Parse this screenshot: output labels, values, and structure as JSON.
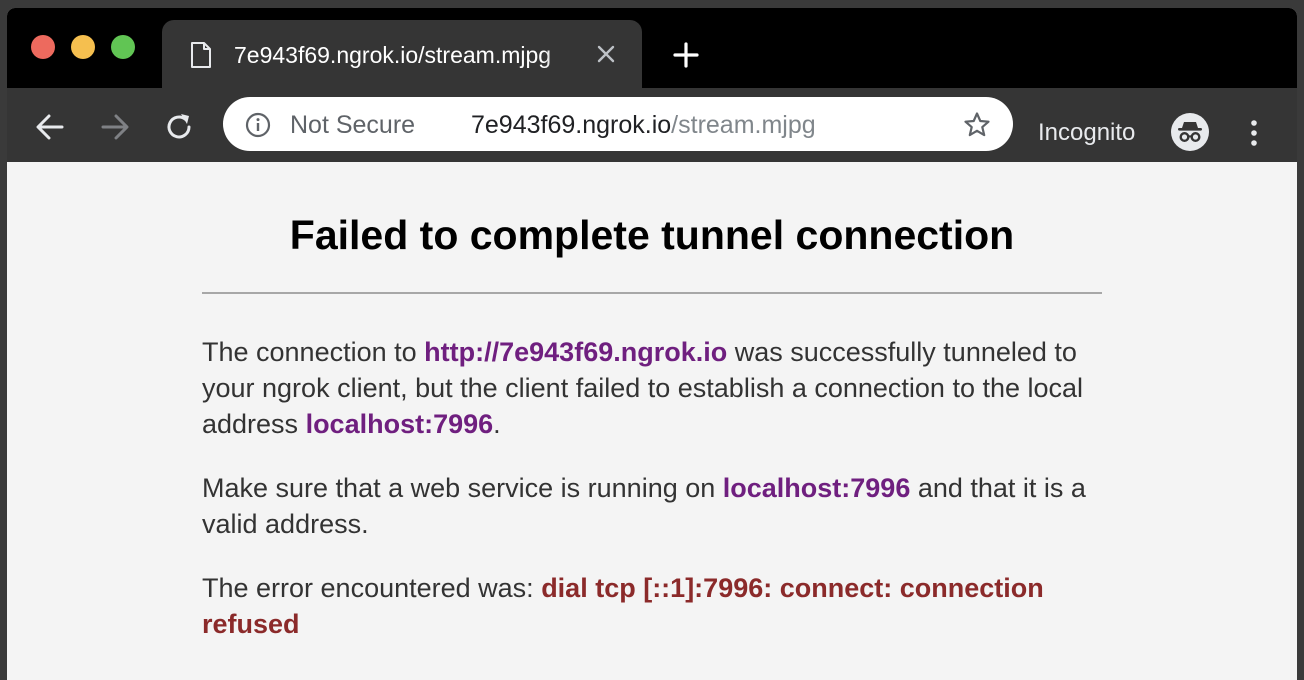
{
  "colors": {
    "tab_bg": "#353535",
    "toolbar_bg": "#353535",
    "titlebar_bg": "#000000",
    "link": "#6f1f7f",
    "error": "#8b2a2a",
    "text": "#333333"
  },
  "window_controls": [
    "close-icon",
    "minimize-icon",
    "maximize-icon"
  ],
  "tab": {
    "icon": "document-icon",
    "title": "7e943f69.ngrok.io/stream.mjpg",
    "close_icon": "close-icon"
  },
  "new_tab_icon": "plus-icon",
  "toolbar": {
    "back_icon": "arrow-left-icon",
    "forward_icon": "arrow-right-icon",
    "reload_icon": "reload-icon",
    "omnibox": {
      "security_icon": "info-icon",
      "security_label": "Not Secure",
      "url_host": "7e943f69.ngrok.io",
      "url_path": "/stream.mjpg",
      "bookmark_icon": "star-icon"
    },
    "profile_label": "Incognito",
    "profile_icon": "incognito-icon",
    "menu_icon": "kebab-menu-icon"
  },
  "page": {
    "heading": "Failed to complete tunnel connection",
    "p1": {
      "before": "The connection to ",
      "link": "http://7e943f69.ngrok.io",
      "middle": " was successfully tunneled to your ngrok client, but the client failed to establish a connection to the local address ",
      "address": "localhost:7996",
      "after": "."
    },
    "p2": {
      "before": "Make sure that a web service is running on ",
      "address": "localhost:7996",
      "after": " and that it is a valid address."
    },
    "p3": {
      "before": "The error encountered was: ",
      "error": "dial tcp [::1]:7996: connect: connection refused"
    }
  }
}
